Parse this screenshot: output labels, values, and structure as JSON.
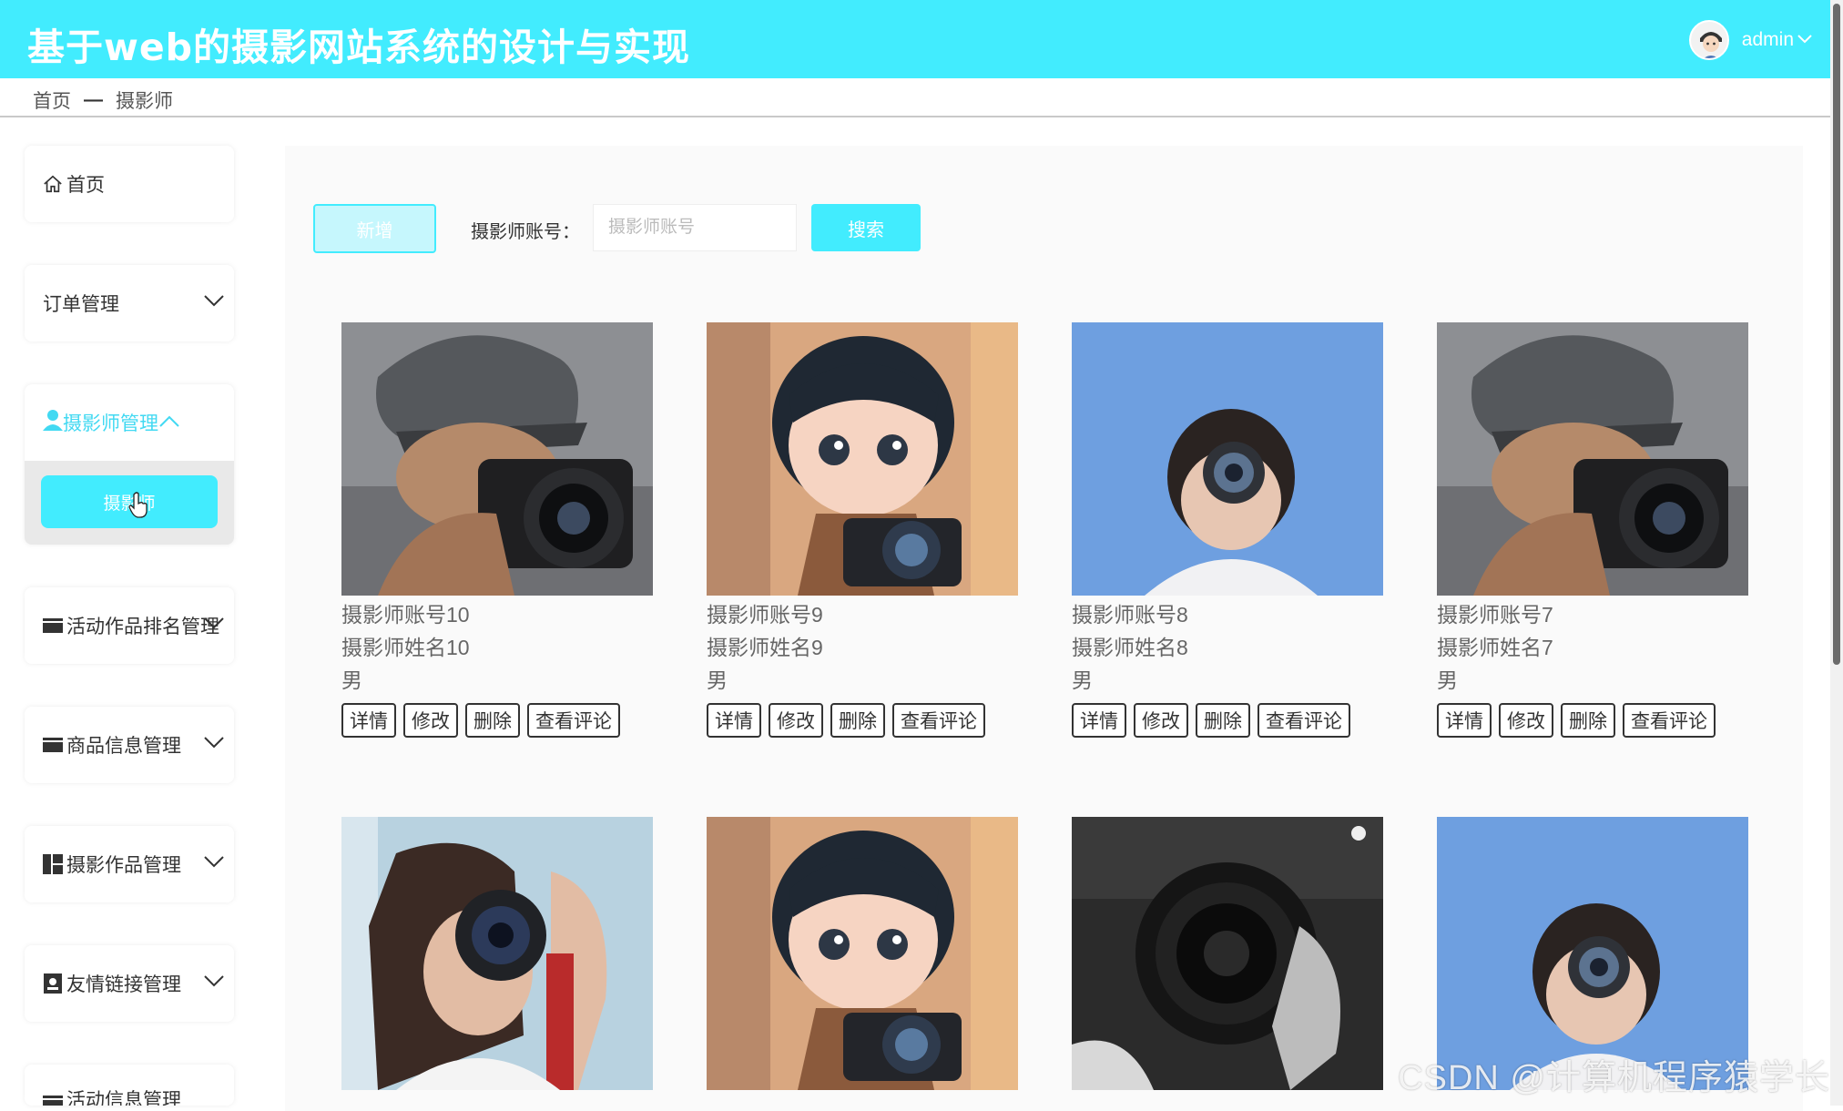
{
  "header": {
    "title": "基于web的摄影网站系统的设计与实现",
    "user": {
      "name": "admin"
    }
  },
  "breadcrumb": {
    "home": "首页",
    "separator": "—",
    "current": "摄影师"
  },
  "sidebar": {
    "items": [
      {
        "label": "首页",
        "icon": "home-icon"
      },
      {
        "label": "订单管理",
        "icon": ""
      },
      {
        "label": "摄影师管理",
        "icon": "user-icon",
        "sub": "摄影师"
      },
      {
        "label": "活动作品排名管理",
        "icon": "card-icon"
      },
      {
        "label": "商品信息管理",
        "icon": "card-icon"
      },
      {
        "label": "摄影作品管理",
        "icon": "grid-icon"
      },
      {
        "label": "友情链接管理",
        "icon": "contact-icon"
      },
      {
        "label": "活动信息管理",
        "icon": "card-icon"
      }
    ]
  },
  "toolbar": {
    "add_label": "新增",
    "search_label": "摄影师账号：",
    "search_placeholder": "摄影师账号",
    "search_button": "搜索"
  },
  "actions": {
    "detail": "详情",
    "edit": "修改",
    "delete": "删除",
    "comments": "查看评论"
  },
  "photographers": [
    {
      "account": "摄影师账号10",
      "name": "摄影师姓名10",
      "gender": "男",
      "photo": "man-cap-camera"
    },
    {
      "account": "摄影师账号9",
      "name": "摄影师姓名9",
      "gender": "男",
      "photo": "cartoon-boy-camera"
    },
    {
      "account": "摄影师账号8",
      "name": "摄影师姓名8",
      "gender": "男",
      "photo": "woman-sky-camera"
    },
    {
      "account": "摄影师账号7",
      "name": "摄影师姓名7",
      "gender": "男",
      "photo": "man-cap-camera"
    },
    {
      "account": "",
      "name": "",
      "gender": "",
      "photo": "woman-camera-strap"
    },
    {
      "account": "",
      "name": "",
      "gender": "",
      "photo": "cartoon-boy-camera"
    },
    {
      "account": "",
      "name": "",
      "gender": "",
      "photo": "bw-lens-closeup"
    },
    {
      "account": "",
      "name": "",
      "gender": "",
      "photo": "woman-sky-camera"
    }
  ],
  "watermark": "CSDN @计算机程序猿学长",
  "colors": {
    "accent": "#42ecfe",
    "active_text": "#42d9f2"
  }
}
